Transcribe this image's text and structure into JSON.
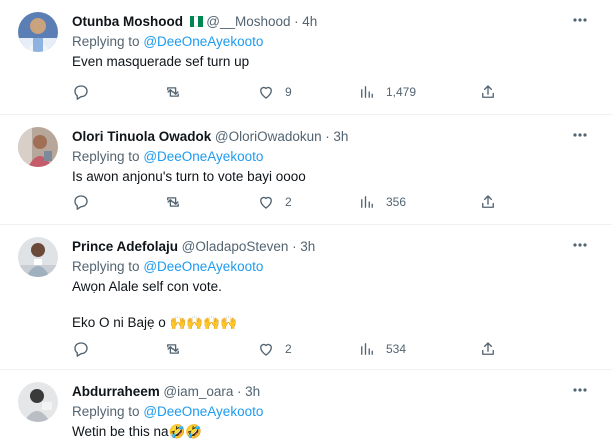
{
  "tweets": [
    {
      "name": "Otunba Moshood",
      "has_flag": true,
      "handle": "@__Moshood",
      "sep": "·",
      "time": "4h",
      "replying_prefix": "Replying to",
      "replying_to": "@DeeOneAyekooto",
      "lines": [
        "Even masquerade sef turn up"
      ],
      "replies": "",
      "retweets": "",
      "likes": "9",
      "views": "1,479"
    },
    {
      "name": "Olori Tinuola Owadok",
      "has_flag": false,
      "handle": "@OloriOwadokun",
      "sep": "·",
      "time": "3h",
      "replying_prefix": "Replying to",
      "replying_to": "@DeeOneAyekooto",
      "lines": [
        "Is awon anjonu's turn to vote bayi oooo"
      ],
      "replies": "",
      "retweets": "",
      "likes": "2",
      "views": "356"
    },
    {
      "name": "Prince Adefolaju",
      "has_flag": false,
      "handle": "@OladapoSteven",
      "sep": "·",
      "time": "3h",
      "replying_prefix": "Replying to",
      "replying_to": "@DeeOneAyekooto",
      "lines": [
        "Awọn Alale self con vote.",
        "Eko O ni Bajẹ o 🙌🙌🙌🙌"
      ],
      "replies": "",
      "retweets": "",
      "likes": "2",
      "views": "534"
    },
    {
      "name": "Abdurraheem",
      "has_flag": false,
      "handle": "@iam_oara",
      "sep": "·",
      "time": "3h",
      "replying_prefix": "Replying to",
      "replying_to": "@DeeOneAyekooto",
      "lines": [
        "Wetin be this na🤣🤣"
      ]
    }
  ],
  "icons": {
    "reply": "reply-icon",
    "retweet": "retweet-icon",
    "like": "heart-icon",
    "views": "views-icon",
    "share": "share-icon",
    "more": "more-icon"
  },
  "colors": {
    "text": "#0f1419",
    "secondary": "#536471",
    "mention": "#1d9bf0",
    "divider": "#eff3f4",
    "flag_green": "#008751"
  }
}
